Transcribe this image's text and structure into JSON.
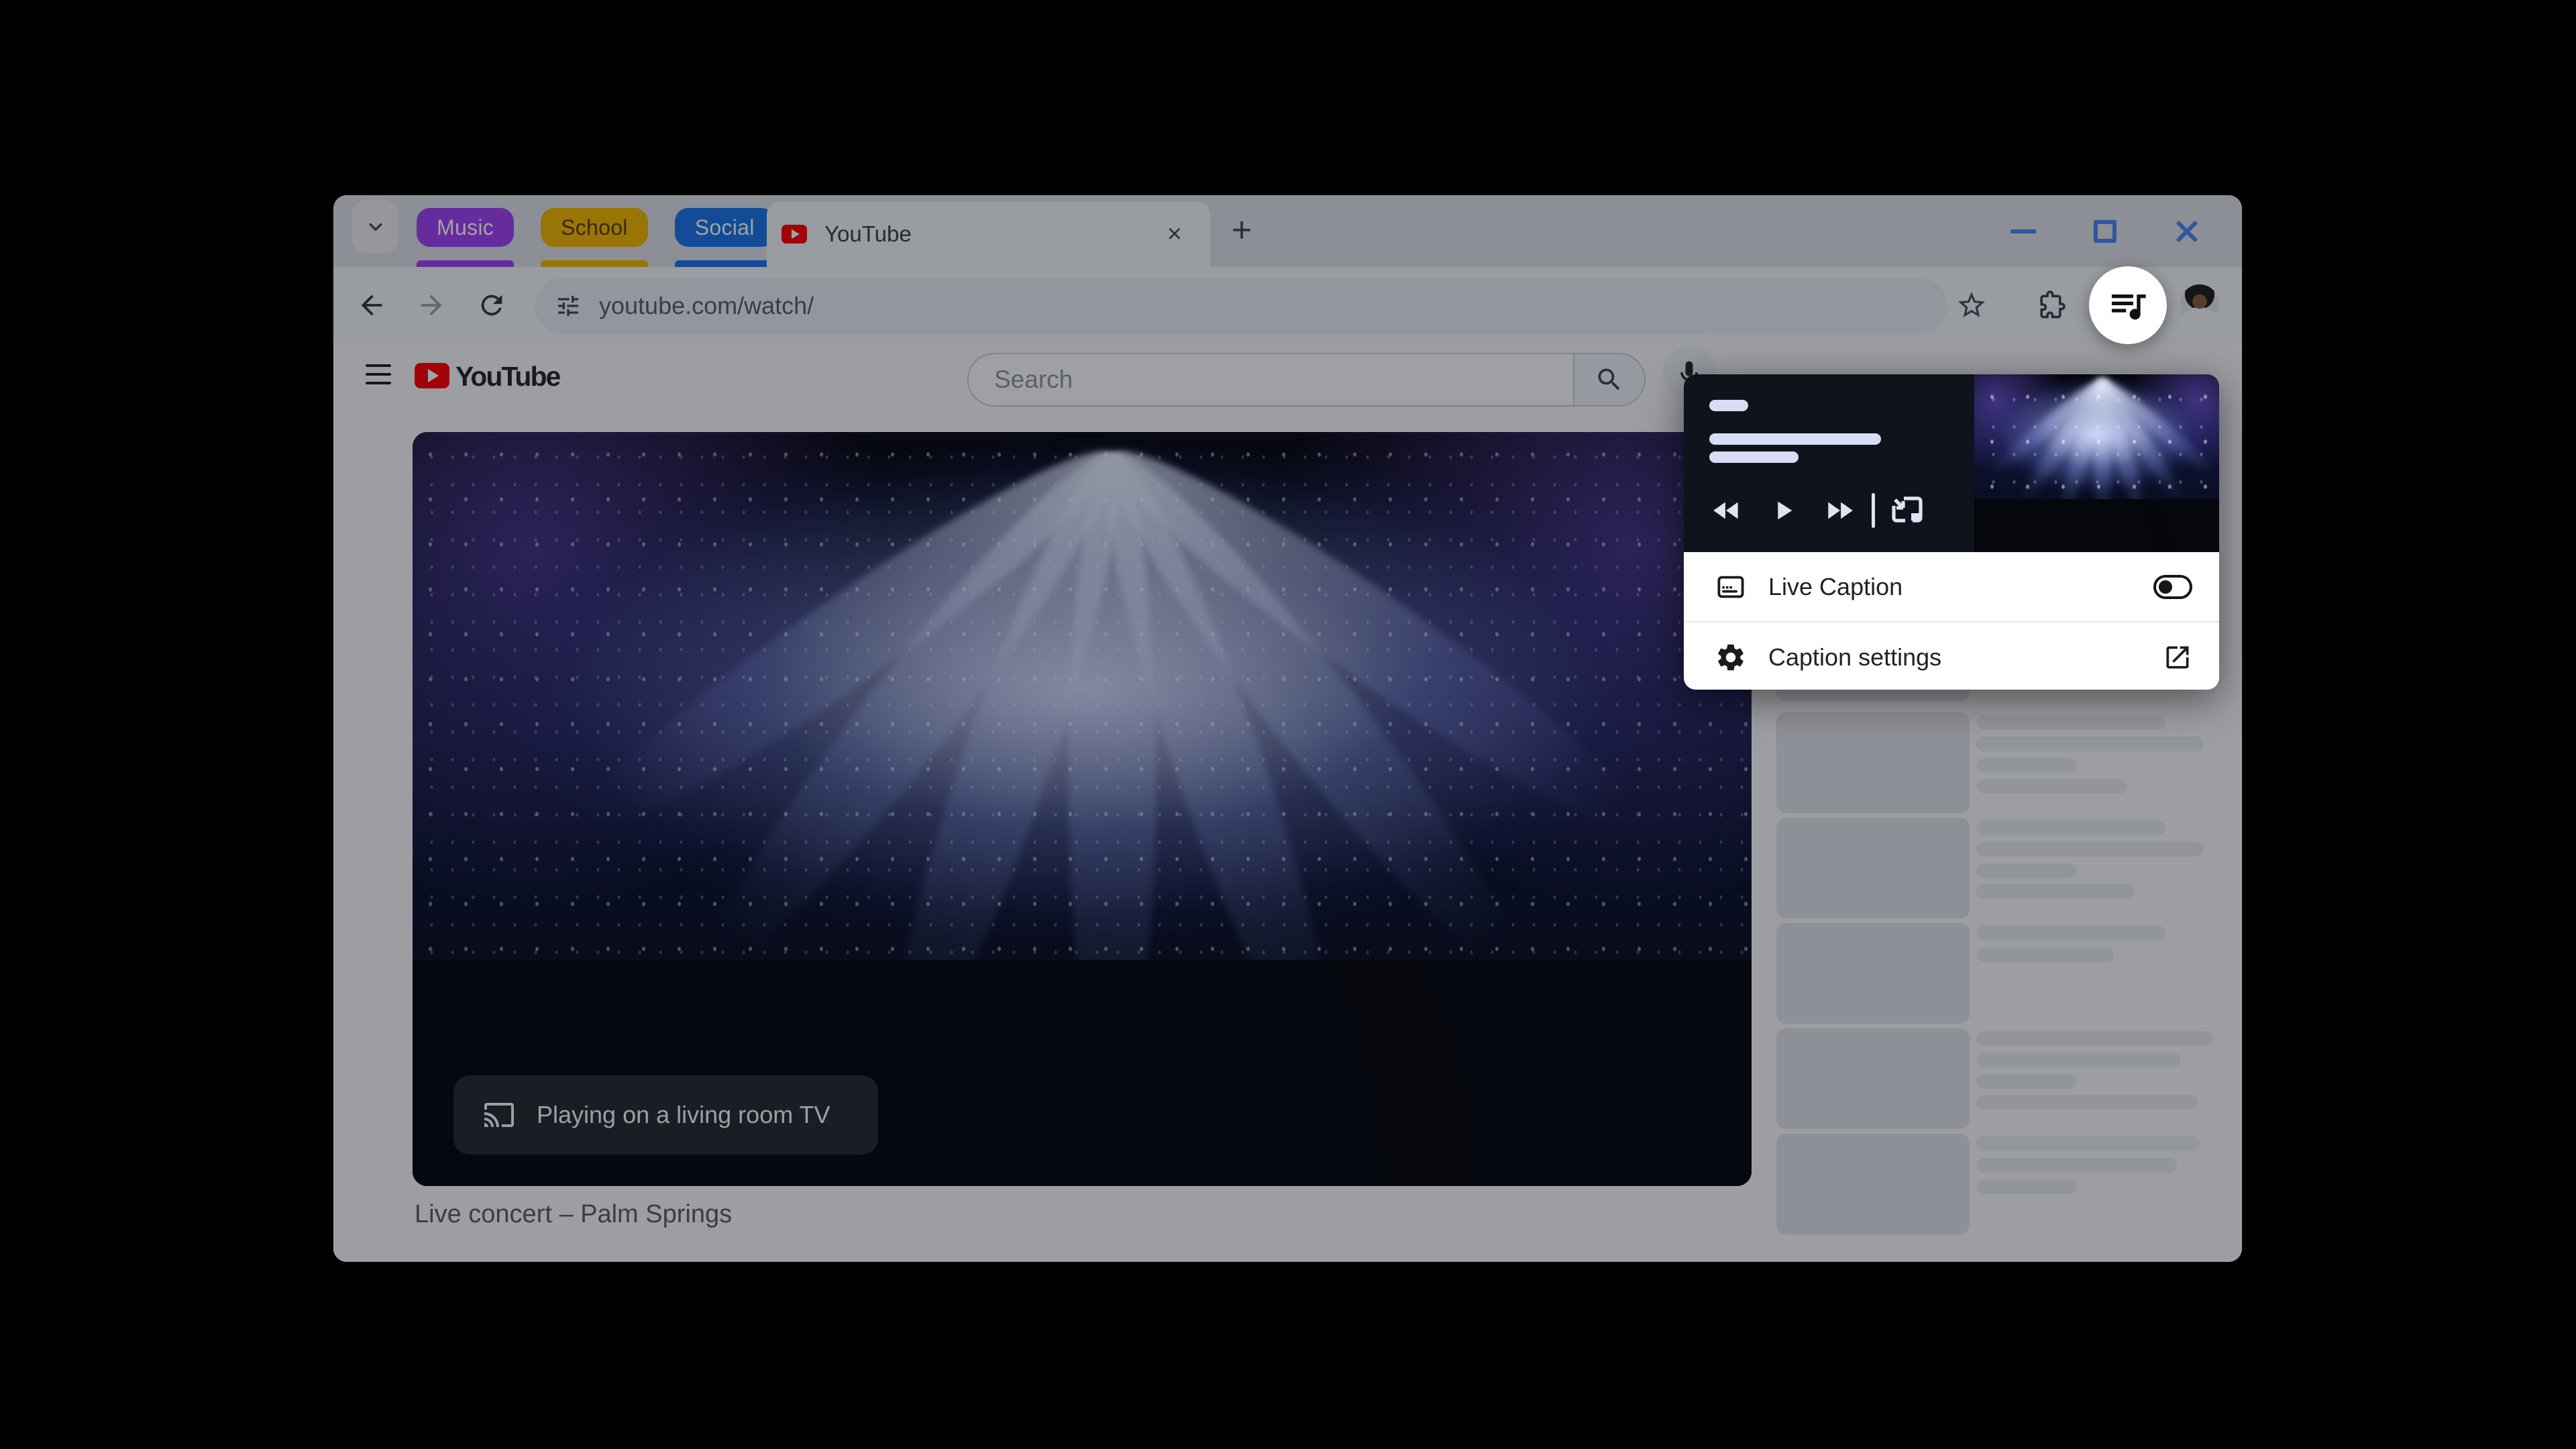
{
  "chrome": {
    "tab_groups": [
      {
        "label": "Music",
        "color": "#a142f4",
        "text_color": "#ffffff"
      },
      {
        "label": "School",
        "color": "#f2b600",
        "text_color": "#513f00"
      },
      {
        "label": "Social",
        "color": "#1a73e8",
        "text_color": "#ffffff"
      }
    ],
    "active_tab": {
      "title": "YouTube",
      "favicon": "youtube-favicon"
    },
    "glyphs": {
      "close_tab": "×",
      "new_tab": "+"
    },
    "url": "youtube.com/watch/",
    "window_controls": [
      "minimize",
      "maximize",
      "close"
    ]
  },
  "youtube": {
    "search_placeholder": "Search",
    "cast_status": "Playing on a living room TV",
    "video_title": "Live concert – Palm Springs"
  },
  "media_popup": {
    "live_caption": {
      "label": "Live Caption",
      "enabled": false
    },
    "caption_settings": {
      "label": "Caption settings"
    },
    "controls": [
      "previous-track",
      "play",
      "next-track",
      "picture-in-picture"
    ]
  },
  "sidebar": {
    "skeleton_items": [
      {
        "partial": true,
        "lines": []
      },
      {
        "partial": false,
        "lines": [
          282,
          339,
          149,
          224
        ]
      },
      {
        "partial": false,
        "lines": [
          282,
          339,
          149,
          236
        ]
      },
      {
        "partial": false,
        "lines": [
          282,
          205
        ]
      },
      {
        "partial": false,
        "lines": [
          353,
          304,
          149,
          331
        ]
      },
      {
        "partial": false,
        "lines": [
          333,
          299,
          149
        ]
      }
    ]
  },
  "colors": {
    "accent_blue": "#4687f4",
    "youtube_red": "#ff0000",
    "popup_card_bg": "#0f131b",
    "placeholder_bar": "#d8ddf4"
  }
}
